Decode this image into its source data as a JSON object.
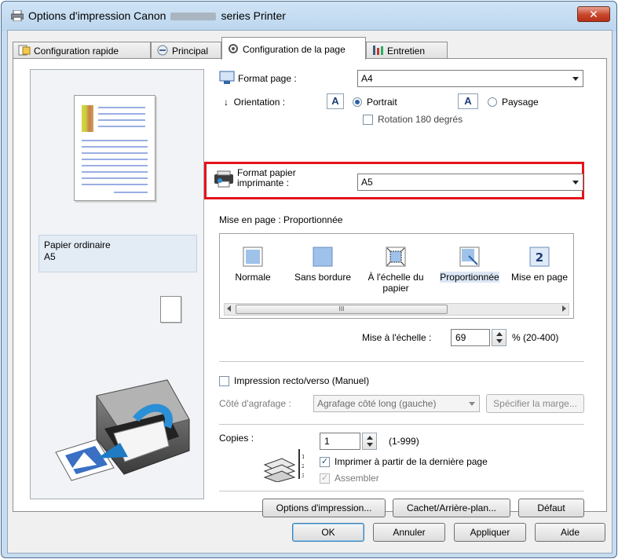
{
  "window": {
    "title_prefix": "Options d'impression Canon",
    "title_suffix": "series Printer",
    "close_label": "✕"
  },
  "tabs": [
    {
      "label": "Configuration rapide"
    },
    {
      "label": "Principal"
    },
    {
      "label": "Configuration de la page"
    },
    {
      "label": "Entretien"
    }
  ],
  "preview": {
    "media_type": "Papier ordinaire",
    "media_size": "A5"
  },
  "page_setup": {
    "page_size_label": "Format page :",
    "page_size_value": "A4",
    "orientation_label": "Orientation :",
    "orientation_icon_glyph": "A",
    "portrait_label": "Portrait",
    "landscape_label": "Paysage",
    "orientation_selected": "Portrait",
    "rotate_label": "Rotation 180 degrés",
    "printer_paper_label_1": "Format papier",
    "printer_paper_label_2": "imprimante :",
    "printer_paper_value": "A5",
    "layout_label": "Mise en page : Proportionnée",
    "layouts": [
      {
        "label": "Normale"
      },
      {
        "label": "Sans bordure"
      },
      {
        "label_1": "À l'échelle du",
        "label_2": "papier"
      },
      {
        "label": "Proportionnée"
      },
      {
        "label": "Mise en page"
      }
    ],
    "layout_selected": "Proportionnée",
    "scroll_thumb_grip": "III",
    "scaling_label": "Mise à l'échelle :",
    "scaling_value": "69",
    "scaling_range": "% (20-400)",
    "duplex_label": "Impression recto/verso (Manuel)",
    "stapling_label": "Côté d'agrafage :",
    "stapling_value": "Agrafage côté long (gauche)",
    "margin_button": "Spécifier la marge...",
    "copies_label": "Copies :",
    "copies_value": "1",
    "copies_range": "(1-999)",
    "print_from_last_label": "Imprimer à partir de la dernière page",
    "collate_label": "Assembler",
    "print_options_button": "Options d'impression...",
    "stamp_button": "Cachet/Arrière-plan...",
    "defaults_button": "Défaut"
  },
  "footer": {
    "ok": "OK",
    "cancel": "Annuler",
    "apply": "Appliquer",
    "help": "Aide"
  },
  "colors": {
    "highlight_border": "#e3141b",
    "window_frame": "#bcd6ee",
    "accent_blue": "#2c62a6"
  }
}
